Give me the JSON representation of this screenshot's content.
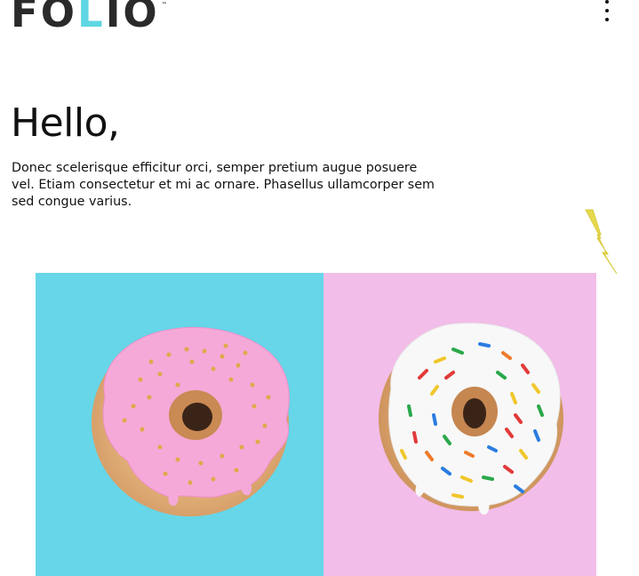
{
  "header": {
    "logo": {
      "text_before": "FO",
      "accent_letter": "L",
      "text_after": "IO",
      "trademark": "™",
      "accent_color": "#5fd6e3"
    },
    "menu_icon": "vertical-dots-icon"
  },
  "intro": {
    "heading": "Hello,",
    "body": "Donec scelerisque efficitur orci, semper pretium augue posuere vel. Etiam consectetur et mi ac ornare. Phasellus ullamcorper sem sed congue varius."
  },
  "decoration": {
    "icon": "lightning-bolt-icon",
    "color": "#e6d94e"
  },
  "photo": {
    "subject": "two-donuts-photo",
    "left_background": "#66d6e8",
    "right_background": "#f2bde8",
    "left_frosting": "#f5a9d8",
    "right_frosting": "#f8f8f8"
  }
}
